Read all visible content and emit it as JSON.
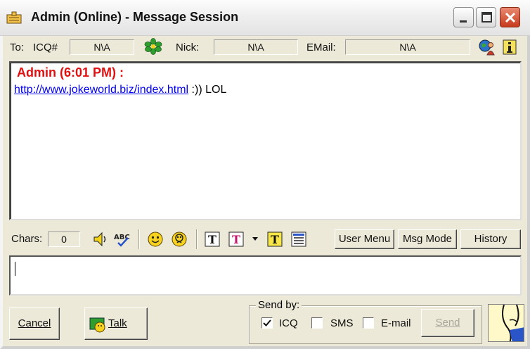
{
  "window": {
    "title": "Admin (Online) - Message Session"
  },
  "contact": {
    "to_label": "To:",
    "icq_label": "ICQ#",
    "icq_value": "N\\A",
    "nick_label": "Nick:",
    "nick_value": "N\\A",
    "email_label": "EMail:",
    "email_value": "N\\A"
  },
  "chat": {
    "messages": [
      {
        "sender": "Admin (6:01 PM) :",
        "link": "http://www.jokeworld.biz/index.html",
        "text": " :)) LOL"
      }
    ]
  },
  "toolbar": {
    "chars_label": "Chars:",
    "chars_value": "0",
    "user_menu_label": "User Menu",
    "msg_mode_label": "Msg Mode",
    "history_label": "History"
  },
  "compose": {
    "value": ""
  },
  "actions": {
    "cancel_label": "Cancel",
    "talk_label": "Talk",
    "send_label": "Send"
  },
  "send_by": {
    "legend": "Send by:",
    "options": [
      {
        "label": "ICQ",
        "checked": true
      },
      {
        "label": "SMS",
        "checked": false
      },
      {
        "label": "E-mail",
        "checked": false
      }
    ]
  },
  "colors": {
    "sender": "#e01010",
    "link": "#0000ee",
    "window_bg": "#ece9d8"
  }
}
